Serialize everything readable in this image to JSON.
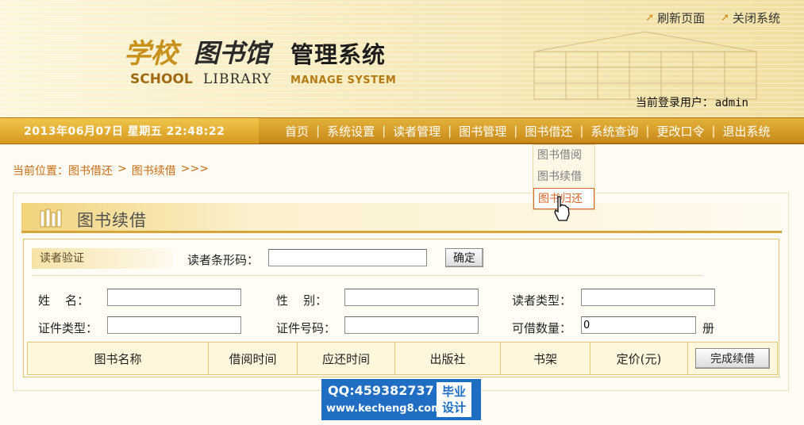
{
  "header": {
    "logo": {
      "school_cn": "学校",
      "library_cn": "图书馆",
      "manage_cn": "管理系统",
      "school_en": "SCHOOL",
      "library_en": "LIBRARY",
      "manage_en": "MANAGE SYSTEM"
    },
    "links": [
      {
        "label": "刷新页面",
        "icon": "arrow-icon"
      },
      {
        "label": "关闭系统",
        "icon": "arrow-icon"
      }
    ],
    "login_label": "当前登录用户：",
    "login_user": "admin"
  },
  "navbar": {
    "datetime": "2013年06月07日 星期五 22:48:22",
    "items": [
      "首页",
      "系统设置",
      "读者管理",
      "图书管理",
      "图书借还",
      "系统查询",
      "更改口令",
      "退出系统"
    ],
    "separator": "|"
  },
  "dropdown": {
    "items": [
      "图书借阅",
      "图书续借",
      "图书归还"
    ],
    "active_index": 2
  },
  "breadcrumb": {
    "prefix": "当前位置：",
    "parent": "图书借还",
    "sep": ">",
    "current": "图书续借",
    "tail": ">>>"
  },
  "panel": {
    "title": "图书续借",
    "verify_label": "读者验证",
    "barcode_label": "读者条形码：",
    "barcode_value": "",
    "confirm_button": "确定",
    "fields": {
      "name_label": "姓    名：",
      "gender_label": "性    别：",
      "reader_type_label": "读者类型：",
      "id_type_label": "证件类型：",
      "id_number_label": "证件号码：",
      "borrow_count_label": "可借数量：",
      "borrow_count_value": "0",
      "borrow_count_unit": "册"
    },
    "table_headers": [
      "图书名称",
      "借阅时间",
      "应还时间",
      "出版社",
      "书架",
      "定价(元)"
    ],
    "complete_button": "完成续借"
  },
  "watermark": {
    "qq": "QQ:459382737",
    "url": "www.kecheng8.com",
    "badge_line1": "毕业",
    "badge_line2": "设计"
  },
  "colors": {
    "nav_bg": "#d79a1f",
    "accent_orange": "#d9662a",
    "breadcrumb": "#c66d13",
    "watermark_blue": "#1f6ec4"
  }
}
